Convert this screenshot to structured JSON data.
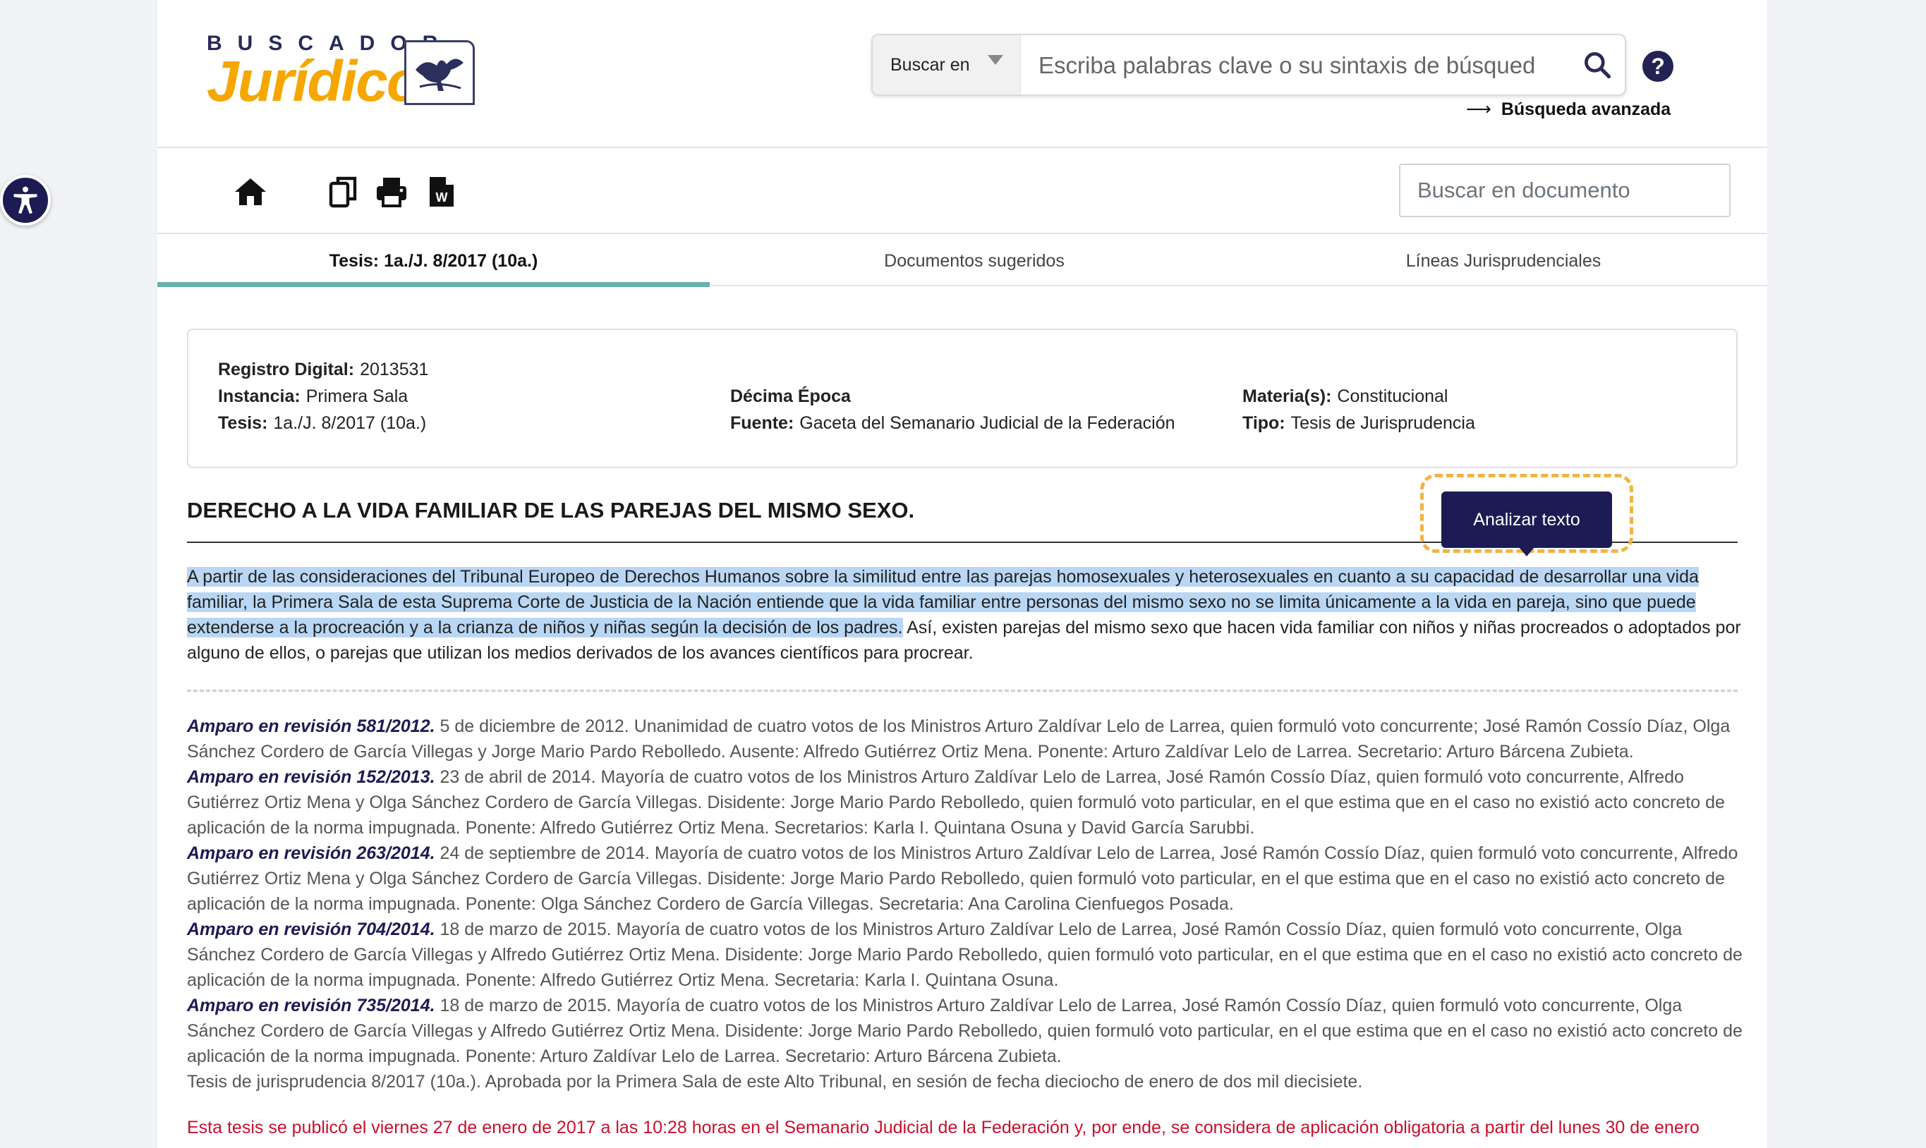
{
  "header": {
    "logo_top": "BUSCADOR",
    "logo_main": "Jurídico",
    "search_in_label": "Buscar en",
    "search_placeholder": "Escriba palabras clave o su sintaxis de búsqued",
    "advanced_search_label": "Búsqueda avanzada"
  },
  "toolbar": {
    "doc_search_placeholder": "Buscar en documento"
  },
  "tabs": [
    {
      "label": "Tesis: 1a./J. 8/2017 (10a.)",
      "active": true
    },
    {
      "label": "Documentos sugeridos",
      "active": false
    },
    {
      "label": "Líneas Jurisprudenciales",
      "active": false
    }
  ],
  "metadata": {
    "registro_label": "Registro Digital:",
    "registro_value": "2013531",
    "instancia_label": "Instancia:",
    "instancia_value": "Primera Sala",
    "tesis_label": "Tesis:",
    "tesis_value": "1a./J. 8/2017 (10a.)",
    "epoca": "Décima Época",
    "fuente_label": "Fuente:",
    "fuente_value": "Gaceta del Semanario Judicial de la Federación",
    "materia_label": "Materia(s):",
    "materia_value": "Constitucional",
    "tipo_label": "Tipo:",
    "tipo_value": "Tesis de Jurisprudencia"
  },
  "document": {
    "title": "DERECHO A LA VIDA FAMILIAR DE LAS PAREJAS DEL MISMO SEXO.",
    "analyze_button": "Analizar texto",
    "body_highlighted": "A partir de las consideraciones del Tribunal Europeo de Derechos Humanos sobre la similitud entre las parejas homosexuales y heterosexuales en cuanto a su capacidad de desarrollar una vida familiar, la Primera Sala de esta Suprema Corte de Justicia de la Nación entiende que la vida familiar entre personas del mismo sexo no se limita únicamente a la vida en pareja, sino que puede extenderse a la procreación y a la crianza de niños y niñas según la decisión de los padres.",
    "body_rest": " Así, existen parejas del mismo sexo que hacen vida familiar con niños y niñas procreados o adoptados por alguno de ellos, o parejas que utilizan los medios derivados de los avances científicos para procrear.",
    "precedents": [
      {
        "ref": "Amparo en revisión 581/2012.",
        "text": " 5 de diciembre de 2012. Unanimidad de cuatro votos de los Ministros Arturo Zaldívar Lelo de Larrea, quien formuló voto concurrente; José Ramón Cossío Díaz, Olga Sánchez Cordero de García Villegas y Jorge Mario Pardo Rebolledo. Ausente: Alfredo Gutiérrez Ortiz Mena. Ponente: Arturo Zaldívar Lelo de Larrea. Secretario: Arturo Bárcena Zubieta."
      },
      {
        "ref": "Amparo en revisión 152/2013.",
        "text": " 23 de abril de 2014. Mayoría de cuatro votos de los Ministros Arturo Zaldívar Lelo de Larrea, José Ramón Cossío Díaz, quien formuló voto concurrente, Alfredo Gutiérrez Ortiz Mena y Olga Sánchez Cordero de García Villegas. Disidente: Jorge Mario Pardo Rebolledo, quien formuló voto particular, en el que estima que en el caso no existió acto concreto de aplicación de la norma impugnada. Ponente: Alfredo Gutiérrez Ortiz Mena. Secretarios: Karla I. Quintana Osuna y David García Sarubbi."
      },
      {
        "ref": "Amparo en revisión 263/2014.",
        "text": " 24 de septiembre de 2014. Mayoría de cuatro votos de los Ministros Arturo Zaldívar Lelo de Larrea, José Ramón Cossío Díaz, quien formuló voto concurrente, Alfredo Gutiérrez Ortiz Mena y Olga Sánchez Cordero de García Villegas. Disidente: Jorge Mario Pardo Rebolledo, quien formuló voto particular, en el que estima que en el caso no existió acto concreto de aplicación de la norma impugnada. Ponente: Olga Sánchez Cordero de García Villegas. Secretaria: Ana Carolina Cienfuegos Posada."
      },
      {
        "ref": "Amparo en revisión 704/2014.",
        "text": " 18 de marzo de 2015. Mayoría de cuatro votos de los Ministros Arturo Zaldívar Lelo de Larrea, José Ramón Cossío Díaz, quien formuló voto concurrente, Olga Sánchez Cordero de García Villegas y Alfredo Gutiérrez Ortiz Mena. Disidente: Jorge Mario Pardo Rebolledo, quien formuló voto particular, en el que estima que en el caso no existió acto concreto de aplicación de la norma impugnada. Ponente: Alfredo Gutiérrez Ortiz Mena. Secretaria: Karla I. Quintana Osuna."
      },
      {
        "ref": "Amparo en revisión 735/2014.",
        "text": " 18 de marzo de 2015. Mayoría de cuatro votos de los Ministros Arturo Zaldívar Lelo de Larrea, José Ramón Cossío Díaz, quien formuló voto concurrente, Olga Sánchez Cordero de García Villegas y Alfredo Gutiérrez Ortiz Mena. Disidente: Jorge Mario Pardo Rebolledo, quien formuló voto particular, en el que estima que en el caso no existió acto concreto de aplicación de la norma impugnada. Ponente: Arturo Zaldívar Lelo de Larrea. Secretario: Arturo Bárcena Zubieta."
      }
    ],
    "tesis_note": "Tesis de jurisprudencia 8/2017 (10a.). Aprobada por la Primera Sala de este Alto Tribunal, en sesión de fecha dieciocho de enero de dos mil diecisiete.",
    "publication_note": "Esta tesis se publicó el viernes 27 de enero de 2017 a las 10:28 horas en el Semanario Judicial de la Federación y, por ende, se considera de aplicación obligatoria a partir del lunes 30 de enero"
  },
  "icons": {
    "accessibility": "accessibility-icon",
    "search": "search-icon",
    "help": "help-icon",
    "home": "home-icon",
    "copy": "copy-icon",
    "print": "print-icon",
    "word": "word-icon"
  },
  "colors": {
    "brand_navy": "#1d1b54",
    "logo_gold": "#f5a700",
    "tab_accent": "#65b3a8",
    "highlight": "#b9d7f5",
    "focus_dash": "#f0b445",
    "publication_red": "#c8102e"
  }
}
